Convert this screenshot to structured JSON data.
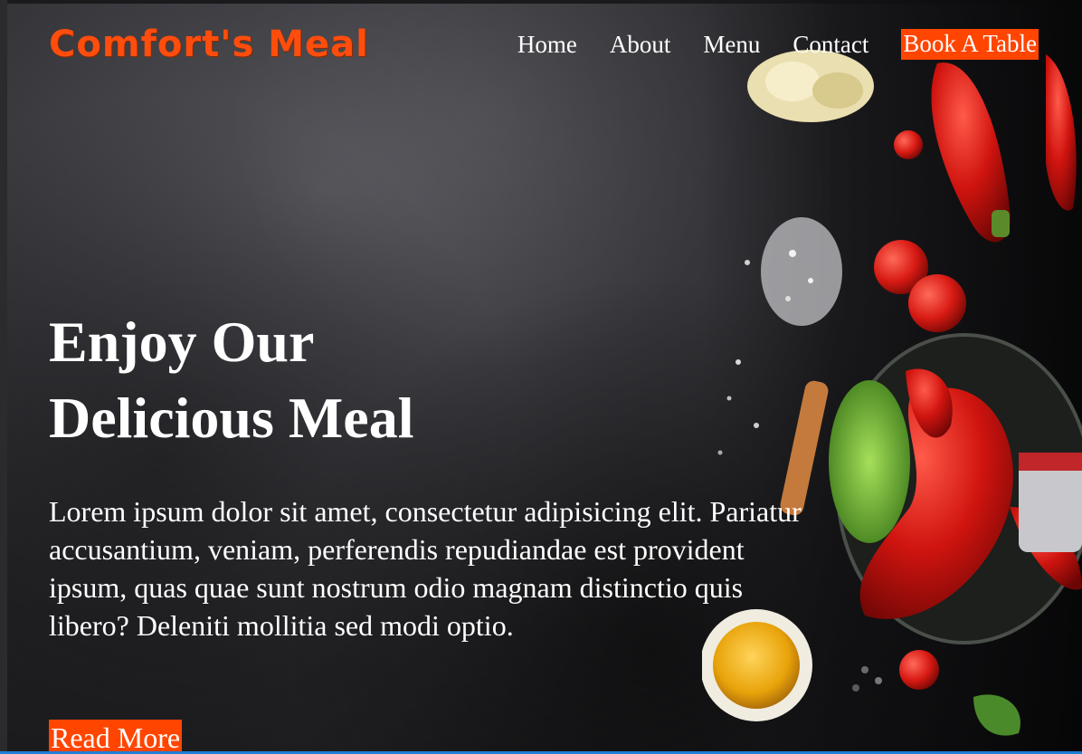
{
  "brand": {
    "logo_text": "Comfort's Meal",
    "accent_color": "#ff4500"
  },
  "nav": {
    "links": [
      "Home",
      "About",
      "Menu",
      "Contact"
    ],
    "cta_label": "Book A Table"
  },
  "hero": {
    "title_line1": "Enjoy Our",
    "title_line2": "Delicious Meal",
    "paragraph": "Lorem ipsum dolor sit amet, consectetur adipisicing elit. Pariatur accusantium, veniam, perferendis repudiandae est provident ipsum, quas quae sunt nostrum odio magnam distinctio quis libero? Deleniti mollitia sed modi optio.",
    "button_label": "Read More",
    "background_image": "dark-slate-with-vegetables"
  }
}
